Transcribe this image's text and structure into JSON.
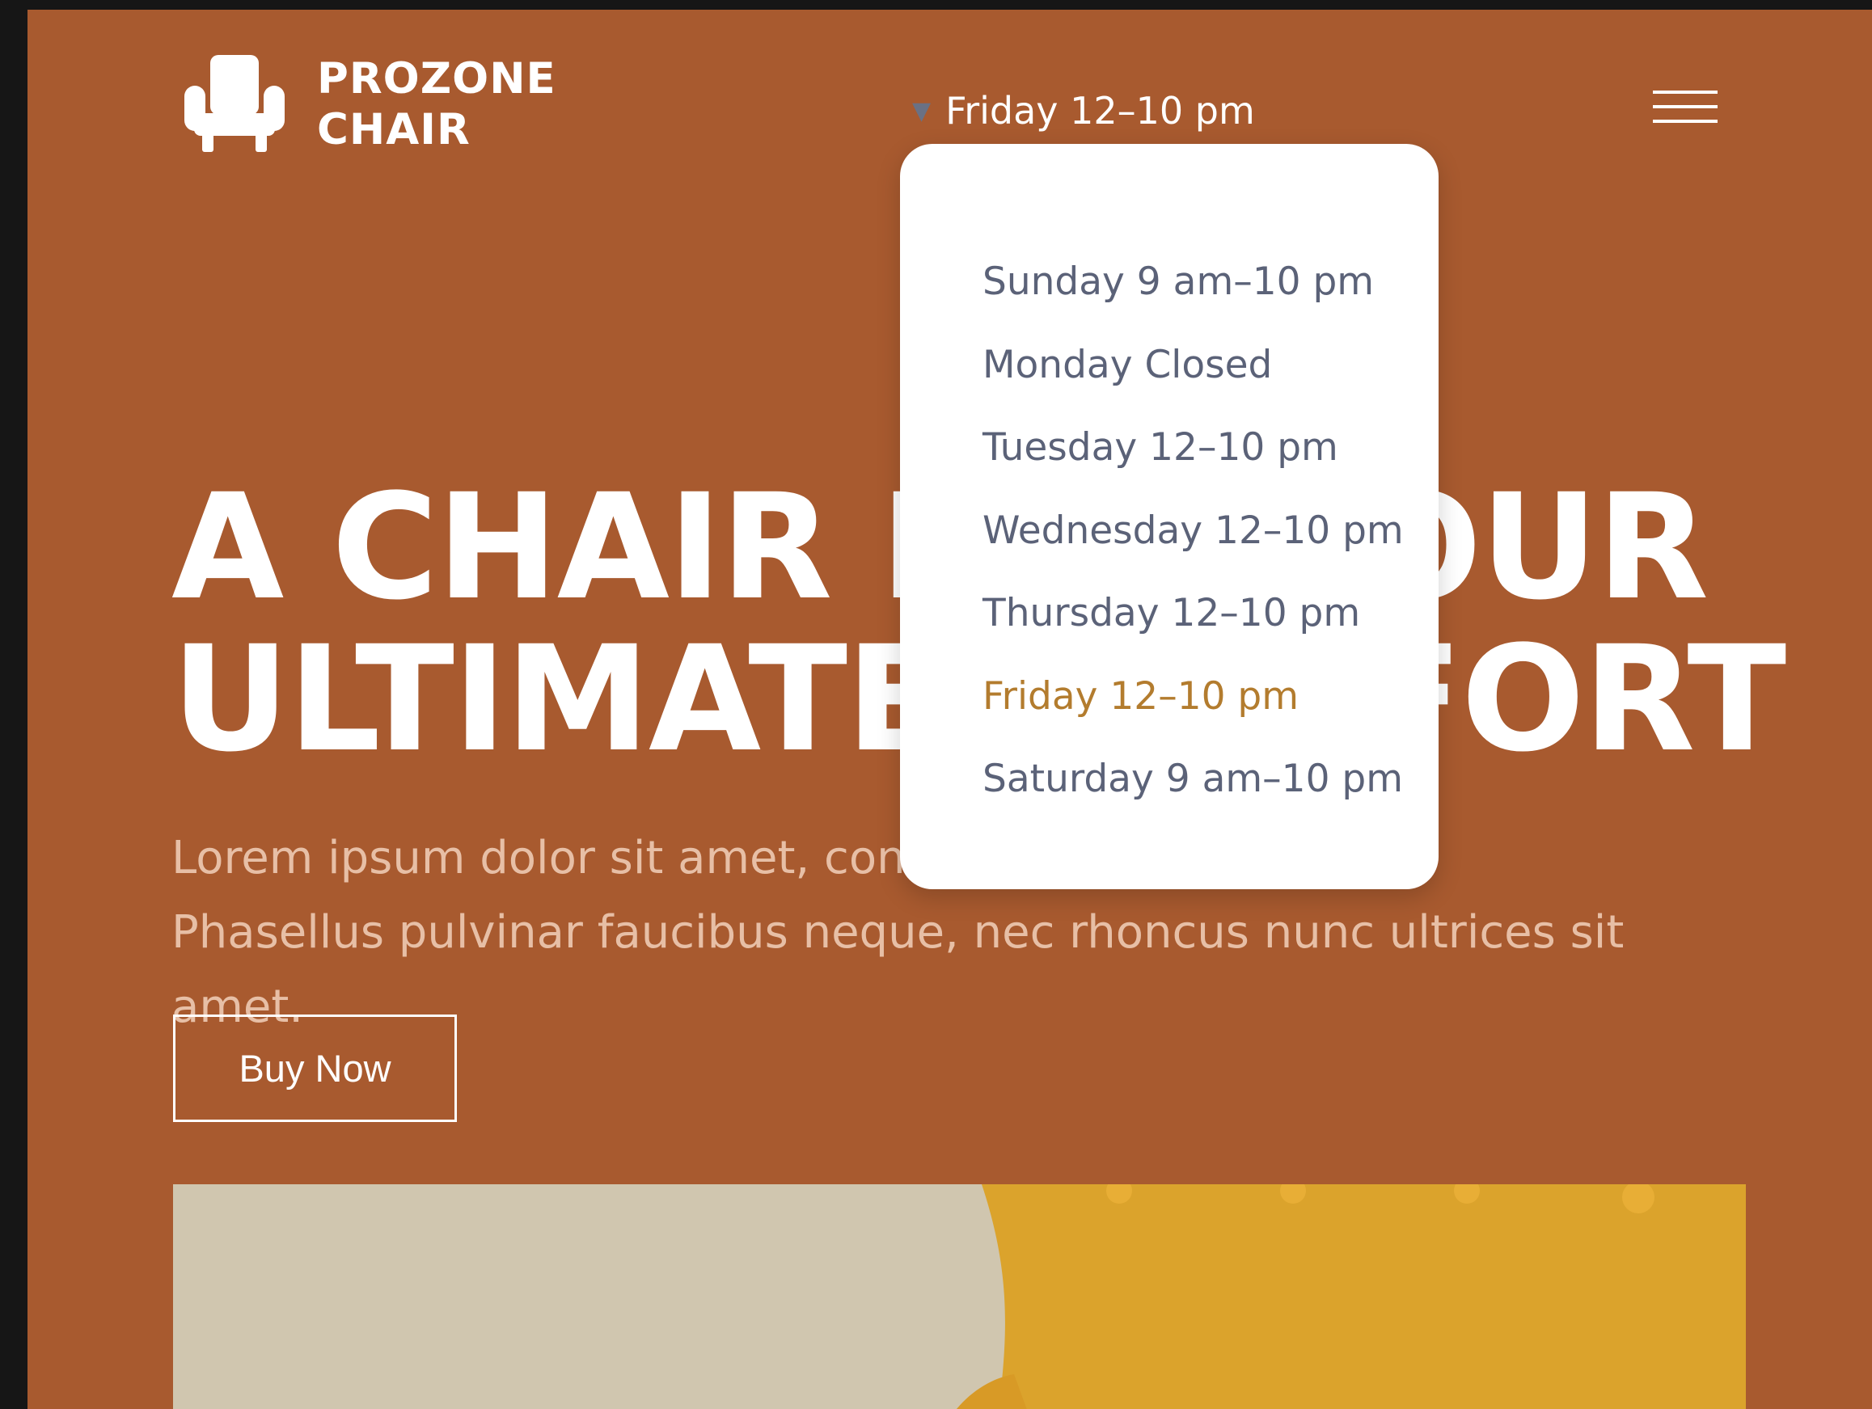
{
  "brand": {
    "line1": "PROZONE",
    "line2": "CHAIR",
    "icon": "armchair-icon"
  },
  "header": {
    "hours_current": "Friday 12–10 pm",
    "caret_icon": "caret-down-icon",
    "menu_icon": "hamburger-menu-icon"
  },
  "hero": {
    "headline_line1": "A CHAIR FOR YOUR",
    "headline_line2": "ULTIMATE COMFORT",
    "subtext": "Lorem ipsum dolor sit amet, consectetur adipiscing elit. Phasellus pulvinar faucibus neque, nec rhoncus nunc ultrices sit amet.",
    "cta_label": "Buy Now"
  },
  "hours_dropdown": {
    "items": [
      "Sunday 9 am–10 pm",
      "Monday Closed",
      "Tuesday 12–10 pm",
      "Wednesday 12–10 pm",
      "Thursday 12–10 pm",
      "Friday 12–10 pm",
      "Saturday 9 am–10 pm"
    ],
    "active_index": 5
  },
  "colors": {
    "background": "#A85A2F",
    "accent": "#B37C2E",
    "dropdown_text": "#5B6278",
    "subtext": "#E7BFA6"
  }
}
